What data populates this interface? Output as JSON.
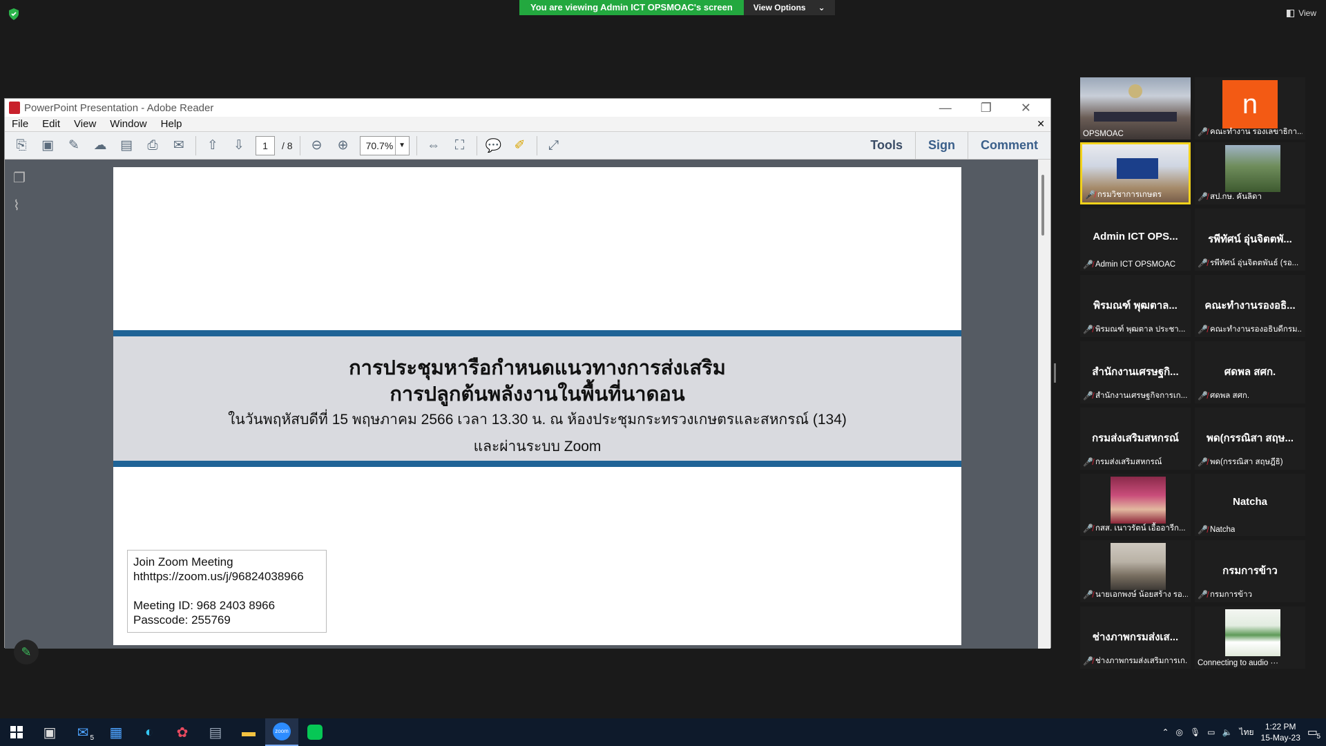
{
  "zoom": {
    "banner_text": "You are viewing Admin ICT OPSMOAC's screen",
    "view_options": "View Options",
    "view_label": "View"
  },
  "adobe": {
    "title": "PowerPoint Presentation - Adobe Reader",
    "menu": [
      "File",
      "Edit",
      "View",
      "Window",
      "Help"
    ],
    "page_current": "1",
    "page_total": "/ 8",
    "zoom_level": "70.7%",
    "right_tools": [
      "Tools",
      "Sign",
      "Comment"
    ]
  },
  "slide": {
    "title_line1": "การประชุมหารือกำหนดแนวทางการส่งเสริม",
    "title_line2": "การปลูกต้นพลังงานในพื้นที่นาดอน",
    "subtitle": "ในวันพฤหัสบดีที่ 15 พฤษภาคม 2566 เวลา 13.30 น. ณ ห้องประชุมกระทรวงเกษตรและสหกรณ์ (134)",
    "subtitle2": "และผ่านระบบ Zoom",
    "join_heading": "Join Zoom Meeting",
    "join_url": "hthttps://zoom.us/j/96824038966",
    "meeting_id": "Meeting ID: 968 2403 8966",
    "passcode": "Passcode: 255769"
  },
  "participants": [
    {
      "name": "",
      "label": "OPSMOAC",
      "muted": false,
      "video": "room"
    },
    {
      "name": "",
      "label": "คณะทำงาน รองเลขาธิกา...",
      "muted": true,
      "video": "avatar-n"
    },
    {
      "name": "",
      "label": "กรมวิชาการเกษตร",
      "muted": true,
      "video": "room2"
    },
    {
      "name": "",
      "label": "สป.กษ. คันลิดา",
      "muted": true,
      "video": "landscape"
    },
    {
      "name": "Admin ICT OPS...",
      "label": "Admin ICT OPSMOAC",
      "muted": true
    },
    {
      "name": "รพีทัศน์ อุ่นจิตตพั...",
      "label": "รพีทัศน์ อุ่นจิตตพันธ์ (รอ...",
      "muted": true
    },
    {
      "name": "พิรมณฑ์ พุฒตาล...",
      "label": "พิรมณฑ์ พุฒตาล ประชา...",
      "muted": true
    },
    {
      "name": "คณะทำงานรองอธิ...",
      "label": "คณะทำงานรองอธิบดีกรม...",
      "muted": true
    },
    {
      "name": "สำนักงานเศรษฐกิ...",
      "label": "สำนักงานเศรษฐกิจการเก...",
      "muted": true
    },
    {
      "name": "ศดพล สศก.",
      "label": "ศดพล สศก.",
      "muted": true
    },
    {
      "name": "กรมส่งเสริมสหกรณ์",
      "label": "กรมส่งเสริมสหกรณ์",
      "muted": true
    },
    {
      "name": "พด(กรรณิสา สฤษ...",
      "label": "พด(กรรณิสา สฤษฎีธิ)",
      "muted": true
    },
    {
      "name": "",
      "label": "กสส. เนาวรัตน์ เอื้ออารีก...",
      "muted": true,
      "video": "person-red"
    },
    {
      "name": "Natcha",
      "label": "Natcha",
      "muted": true
    },
    {
      "name": "",
      "label": "นายเอกพงษ์ น้อยสร้าง รอ...",
      "muted": true,
      "video": "person-suit"
    },
    {
      "name": "กรมการข้าว",
      "label": "กรมการข้าว",
      "muted": true
    },
    {
      "name": "ช่างภาพกรมส่งเส...",
      "label": "ช่างภาพกรมส่งเสริมการเก...",
      "muted": true
    },
    {
      "name": "",
      "label": "Connecting to audio ···",
      "muted": false,
      "video": "slide-thumb"
    }
  ],
  "taskbar": {
    "mail_badge": "5",
    "time": "1:22 PM",
    "date": "15-May-23",
    "lang": "ไทย",
    "notif_count": "5"
  }
}
